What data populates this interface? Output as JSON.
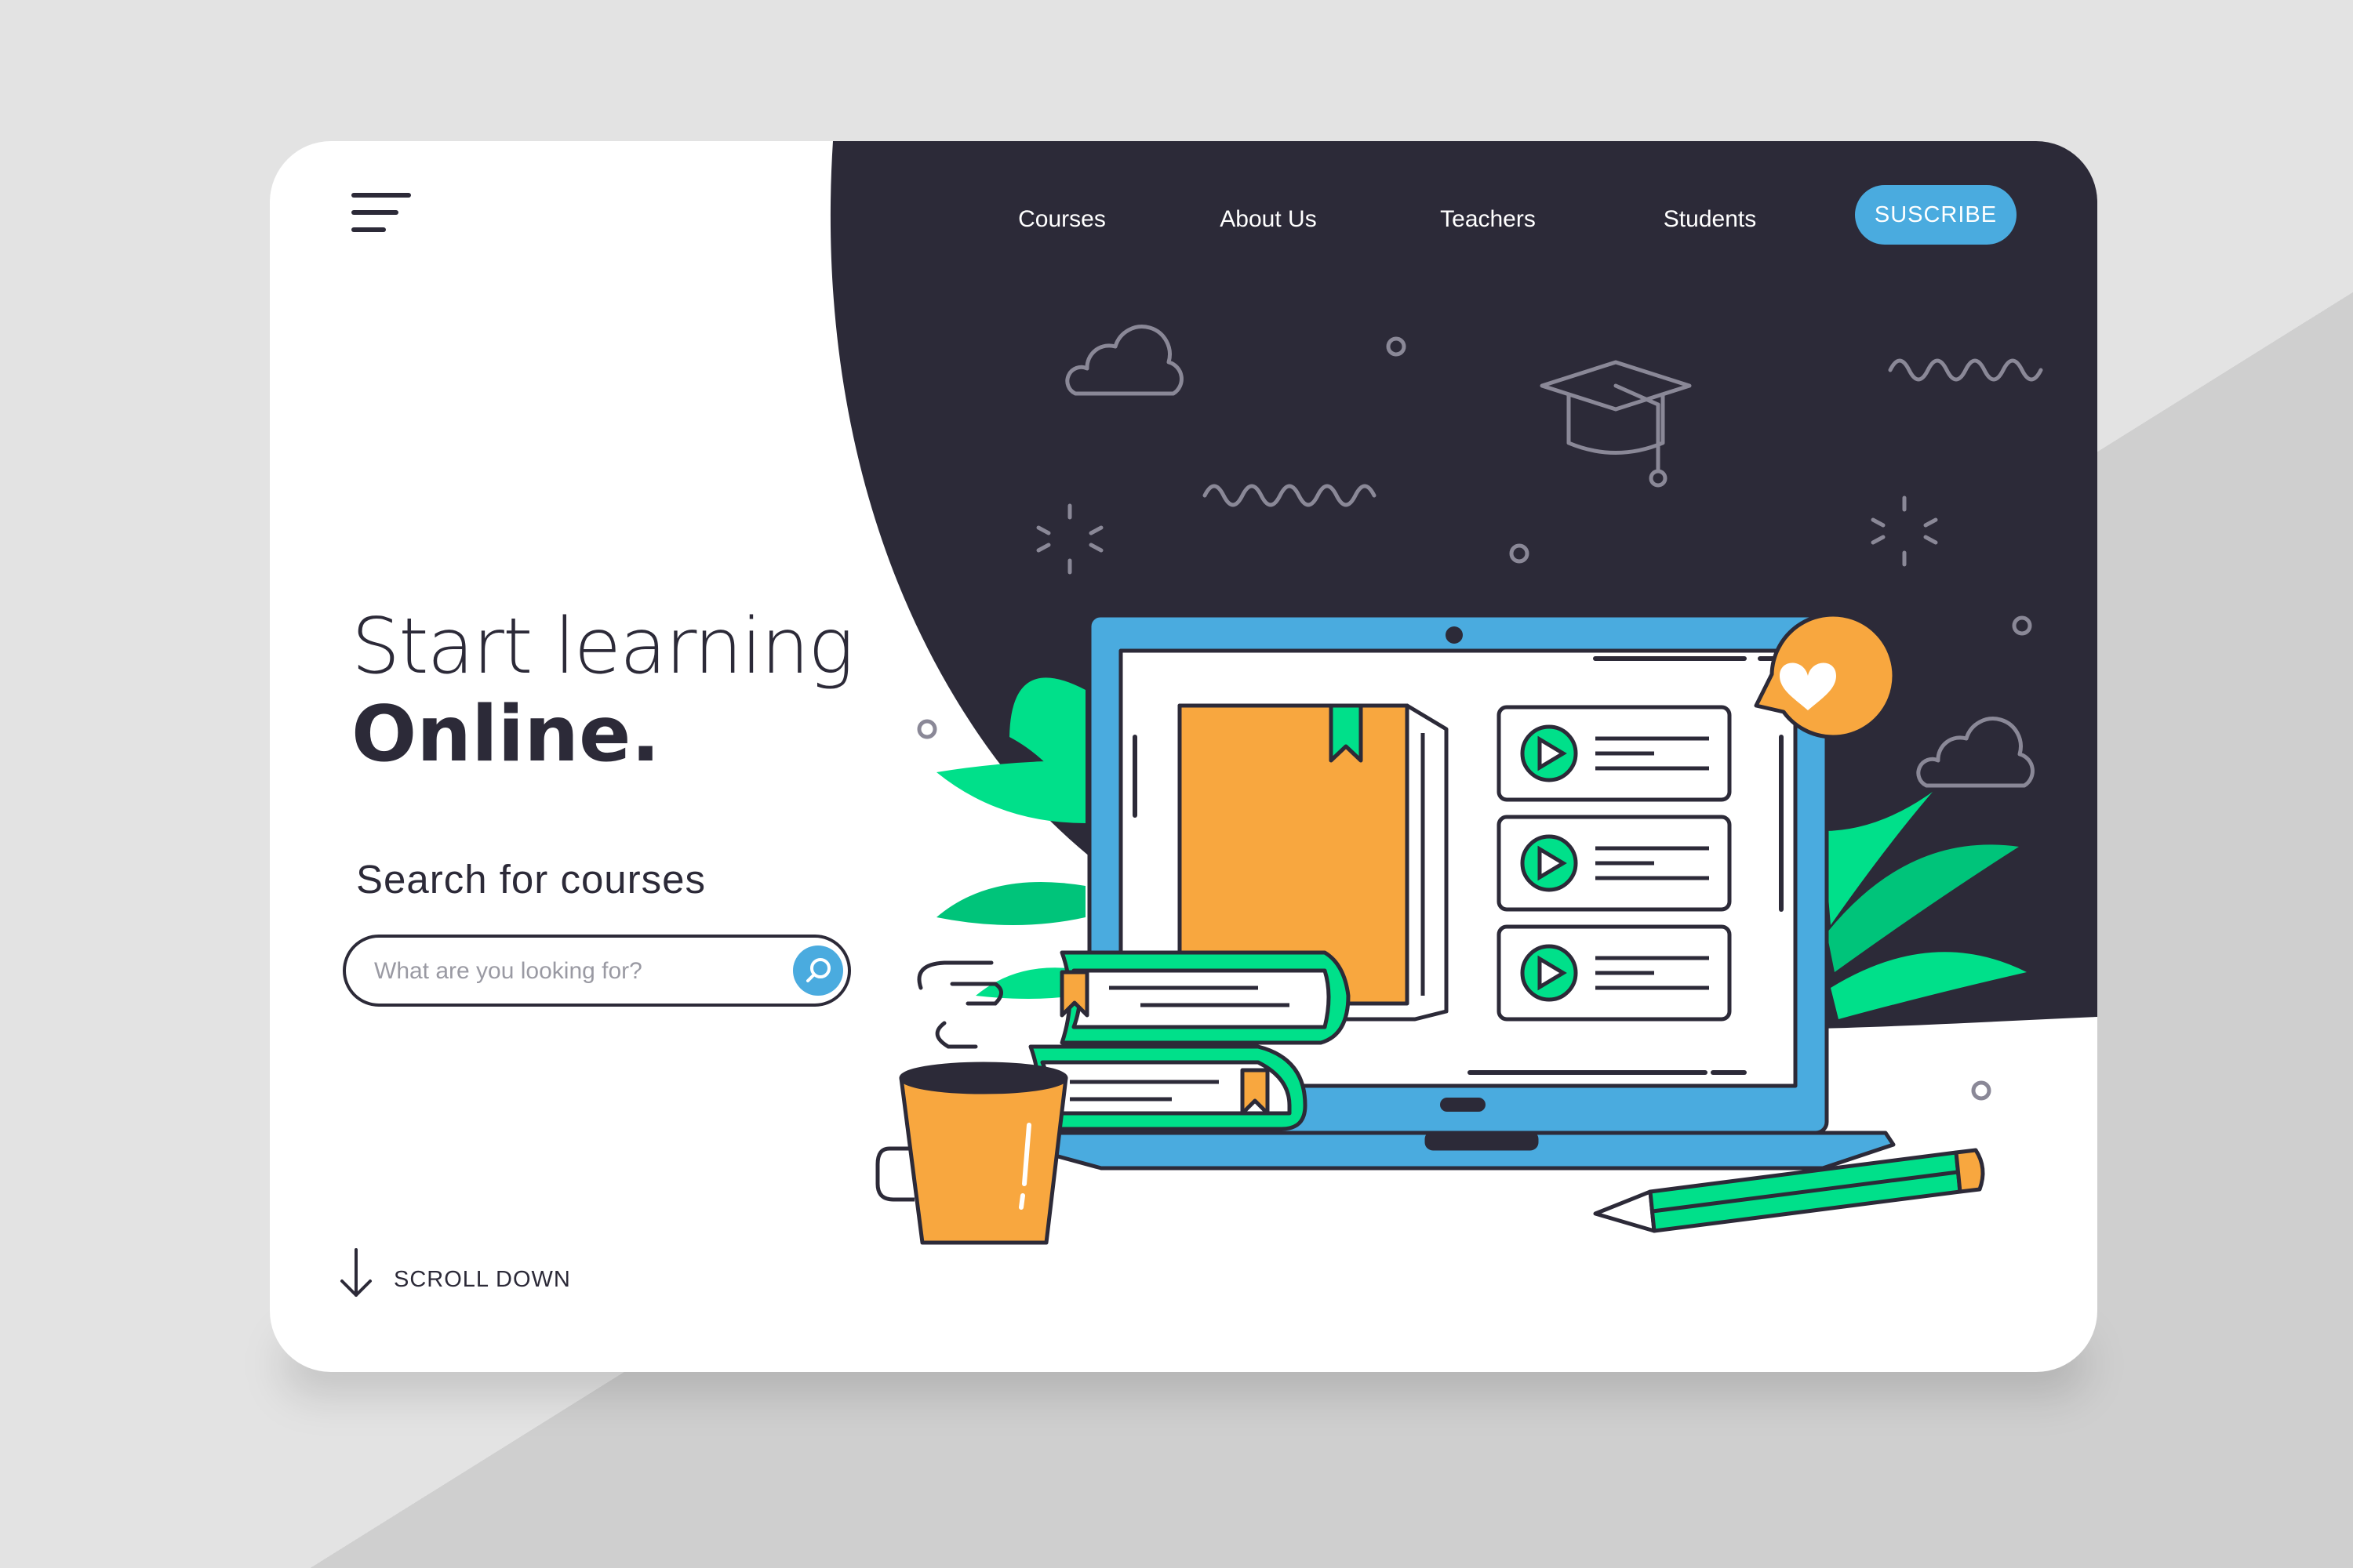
{
  "colors": {
    "dark": "#2c2a38",
    "accent_blue": "#4aabdf",
    "orange": "#f8a73f",
    "green": "#00e08a",
    "background": "#e3e3e3"
  },
  "header": {
    "menu_icon": "hamburger-menu-icon",
    "nav": [
      {
        "label": "Courses"
      },
      {
        "label": "About Us"
      },
      {
        "label": "Teachers"
      },
      {
        "label": "Students"
      }
    ],
    "subscribe_label": "SUSCRIBE"
  },
  "hero": {
    "title_light": "Start learning",
    "title_bold": "Online."
  },
  "search": {
    "heading": "Search for courses",
    "placeholder": "What are you looking for?",
    "value": "",
    "button_icon": "search-icon"
  },
  "scroll": {
    "label": "SCROLL DOWN",
    "icon": "arrow-down-icon"
  },
  "illustration": {
    "video_items": [
      {
        "icon": "play-icon"
      },
      {
        "icon": "play-icon"
      },
      {
        "icon": "play-icon"
      }
    ],
    "badge_icon": "heart-icon"
  }
}
